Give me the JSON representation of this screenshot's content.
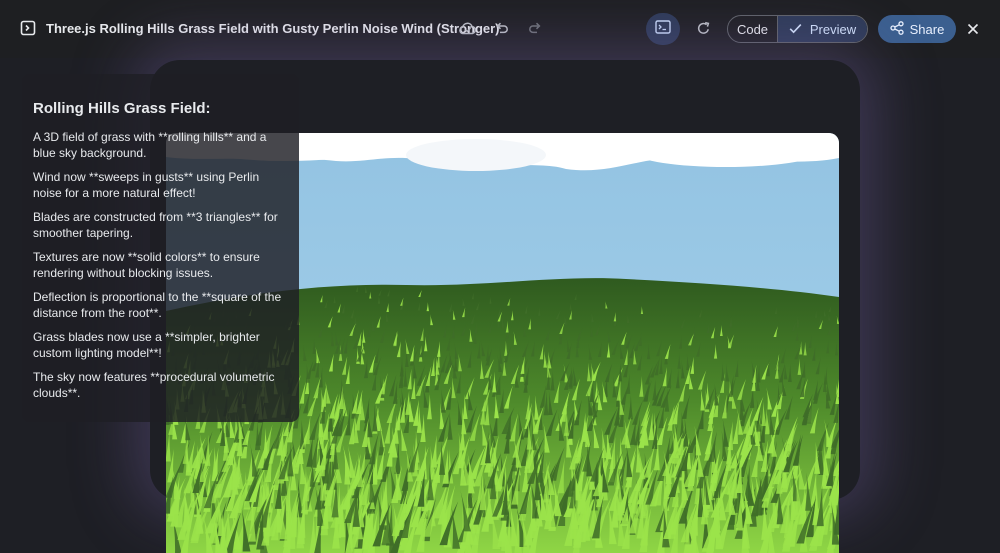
{
  "header": {
    "title": "Three.js Rolling Hills Grass Field with Gusty Perlin Noise Wind (Stronger)",
    "code_label": "Code",
    "preview_label": "Preview",
    "share_label": "Share"
  },
  "icons": {
    "app": "code-window-icon",
    "save": "cloud-save-icon",
    "undo": "undo-icon",
    "redo": "redo-icon",
    "terminal": "terminal-icon",
    "refresh": "refresh-icon",
    "preview_check": "check-icon",
    "share": "share-icon",
    "close": "close-icon"
  },
  "colors": {
    "accent": "#3b5f8f",
    "selected_toggle": "#2d3a57",
    "sky": "#9ccbe6",
    "grass_bright": "#9be34a",
    "grass_dark": "#3f6d28"
  },
  "panel": {
    "heading": "Rolling Hills Grass Field:",
    "paragraphs": [
      "A 3D field of grass with **rolling hills** and a blue sky background.",
      "Wind now **sweeps in gusts** using Perlin noise for a more natural effect!",
      "Blades are constructed from **3 triangles** for smoother tapering.",
      "Textures are now **solid colors** to ensure rendering without blocking issues.",
      "Deflection is proportional to the **square of the distance from the root**.",
      "Grass blades now use a **simpler, brighter custom lighting model**!",
      "The sky now features **procedural volumetric clouds**."
    ]
  }
}
